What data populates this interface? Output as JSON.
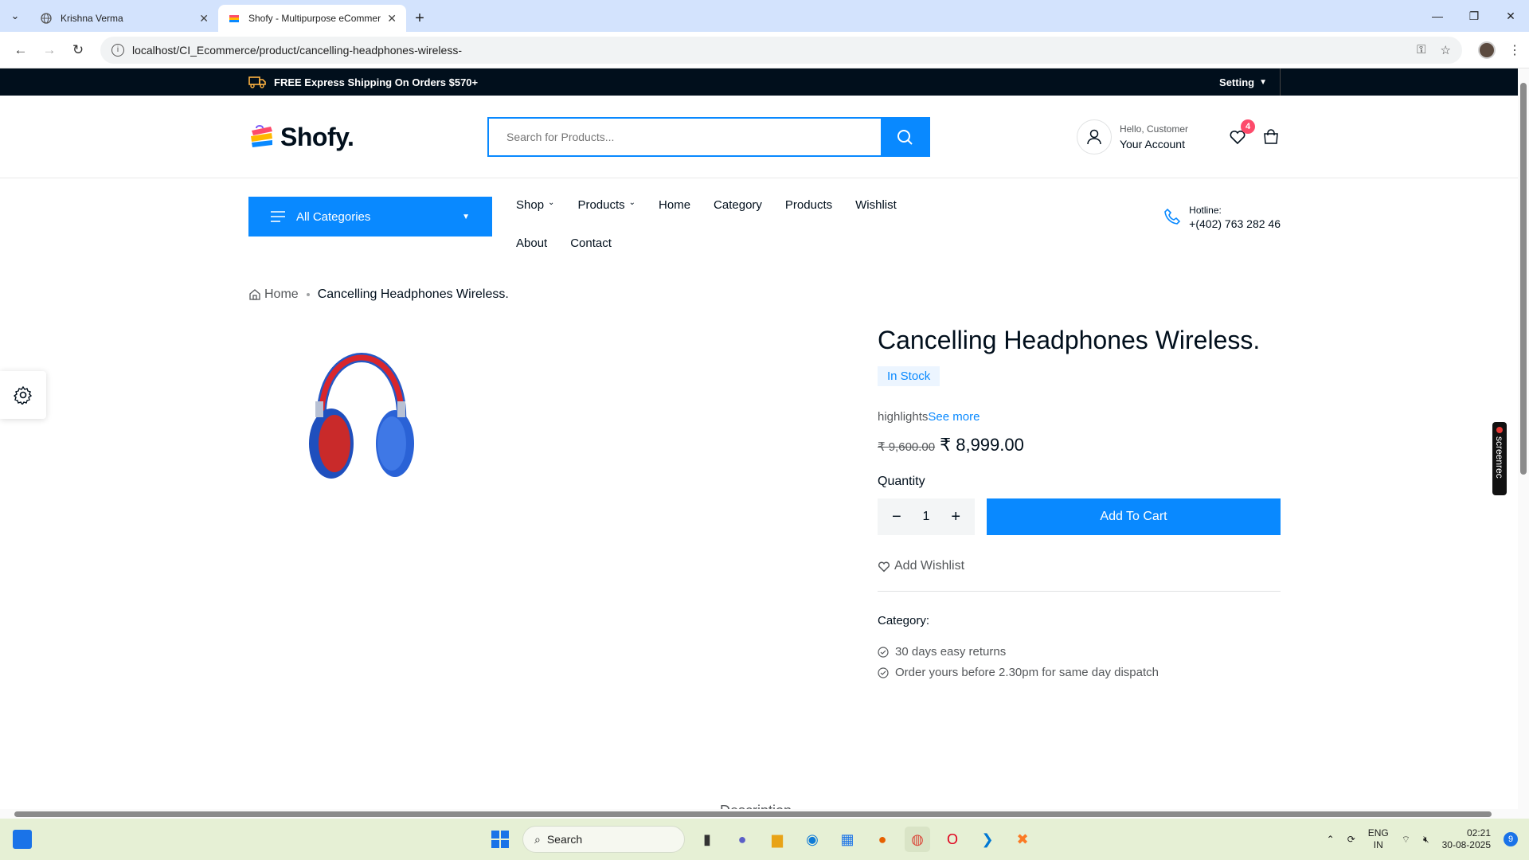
{
  "browser": {
    "tabs": [
      {
        "title": "Krishna Verma",
        "active": false
      },
      {
        "title": "Shofy - Multipurpose eCommer",
        "active": true
      }
    ],
    "url": "localhost/CI_Ecommerce/product/cancelling-headphones-wireless-"
  },
  "topbar": {
    "shipping": "FREE Express Shipping On Orders $570+",
    "setting": "Setting"
  },
  "header": {
    "logo": "Shofy.",
    "search_placeholder": "Search for Products...",
    "greeting": "Hello, Customer",
    "account": "Your Account",
    "wishlist_count": "4"
  },
  "menu": {
    "all_categories": "All Categories",
    "nav": [
      "Shop",
      "Products",
      "Home",
      "Category",
      "Products",
      "Wishlist",
      "About",
      "Contact"
    ],
    "hotline_label": "Hotline:",
    "hotline_number": "+(402) 763 282 46"
  },
  "breadcrumb": {
    "home": "Home",
    "current": "Cancelling Headphones Wireless."
  },
  "product": {
    "title": "Cancelling Headphones Wireless.",
    "stock": "In Stock",
    "highlights": "highlights",
    "see_more": "See more",
    "old_price": "₹ 9,600.00",
    "price": "₹ 8,999.00",
    "quantity_label": "Quantity",
    "quantity": "1",
    "add_to_cart": "Add To Cart",
    "add_wishlist": "Add Wishlist",
    "category_label": "Category:",
    "features": [
      "30 days easy returns",
      "Order yours before 2.30pm for same day dispatch"
    ],
    "description_tab": "Description"
  },
  "taskbar": {
    "search": "Search",
    "lang_1": "ENG",
    "lang_2": "IN",
    "time": "02:21",
    "date": "30-08-2025",
    "notifications": "9"
  },
  "overlay": {
    "screenrec": "screenrec"
  },
  "colors": {
    "accent": "#0989ff",
    "dark": "#010f1c",
    "badge": "#fd4b6b"
  }
}
